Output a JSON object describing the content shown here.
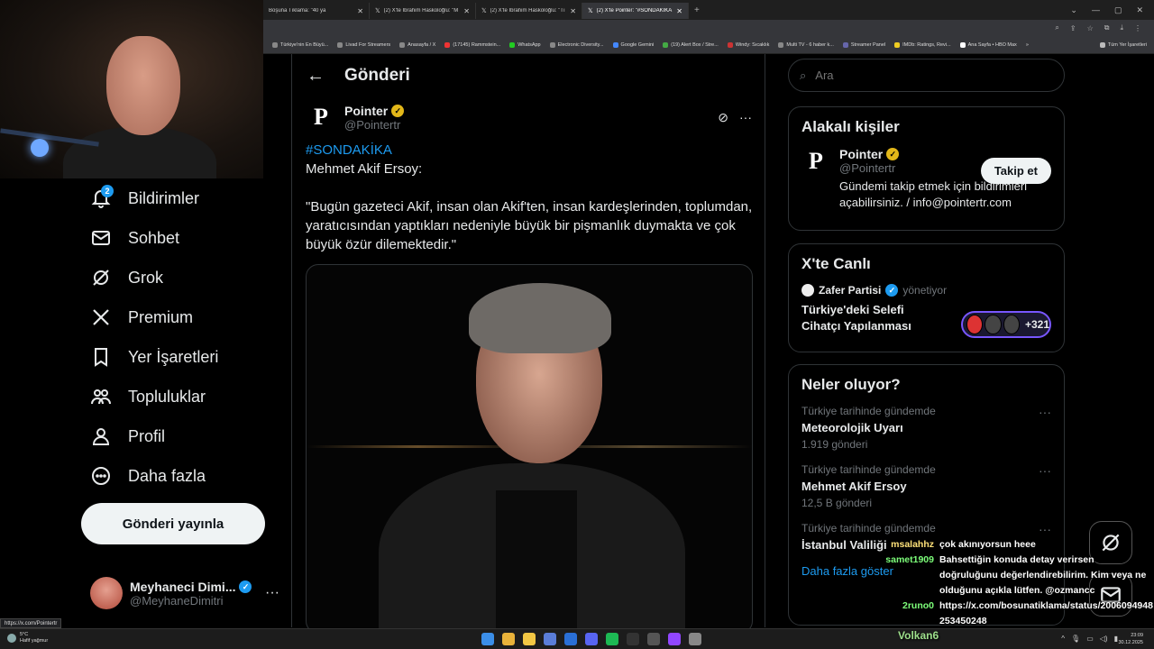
{
  "browser": {
    "tabs": [
      {
        "title": "Boşuna Tıklama: \"40 ya",
        "active": false
      },
      {
        "title": "(2) X'te İbrahim Haskoloğlu: \"M",
        "active": false
      },
      {
        "title": "(2) X'te İbrahim Haskoloğlu: \"Tı",
        "active": false
      },
      {
        "title": "(2) X'te Pointer: \"#SONDAKİKA",
        "active": true
      }
    ],
    "bookmarks": [
      "Türkiye'nin En Büyü...",
      "Livad For Streamers",
      "Anasayfa / X",
      "(17145) Rammstein...",
      "WhatsApp",
      "Electronic Diversity...",
      "Google Gemini",
      "(19) Alert Box / Stre...",
      "Windy: Sıcaklık",
      "Multi TV - 6 haber k...",
      "Streamer Panel",
      "IMDb: Ratings, Revi...",
      "Ana Sayfa • HBO Max"
    ],
    "bookmarks_folder": "Tüm Yer İşaretleri",
    "status_url": "https://x.com/Pointertr"
  },
  "nav": {
    "items": [
      {
        "label": "Bildirimler",
        "icon": "bell-icon",
        "badge": "2"
      },
      {
        "label": "Sohbet",
        "icon": "mail-icon"
      },
      {
        "label": "Grok",
        "icon": "grok-icon"
      },
      {
        "label": "Premium",
        "icon": "x-logo-icon"
      },
      {
        "label": "Yer İşaretleri",
        "icon": "bookmark-icon"
      },
      {
        "label": "Topluluklar",
        "icon": "communities-icon"
      },
      {
        "label": "Profil",
        "icon": "person-icon"
      },
      {
        "label": "Daha fazla",
        "icon": "more-circle-icon"
      }
    ],
    "post_button": "Gönderi yayınla",
    "account": {
      "name": "Meyhaneci Dimi...",
      "handle": "@MeyhaneDimitri",
      "more": "···"
    }
  },
  "post": {
    "header_title": "Gönderi",
    "author_name": "Pointer",
    "author_handle": "@Pointertr",
    "hashtag": "#SONDAKİKA",
    "line1": "Mehmet Akif Ersoy:",
    "quote": "\"Bugün gazeteci Akif, insan olan Akif'ten, insan kardeşlerinden, toplumdan, yaratıcısından yaptıkları nedeniyle büyük bir pişmanlık duymakta ve çok büyük özür dilemektedir.\""
  },
  "sidebar": {
    "search_placeholder": "Ara",
    "related": {
      "title": "Alakalı kişiler",
      "name": "Pointer",
      "handle": "@Pointertr",
      "bio": "Gündemi takip etmek için bildirimleri açabilirsiniz. / info@pointertr.com",
      "follow": "Takip et"
    },
    "live": {
      "title": "X'te Canlı",
      "host": "Zafer Partisi",
      "host_role": "yönetiyor",
      "space_title": "Türkiye'deki Selefi Cihatçı Yapılanması",
      "listeners": "+321"
    },
    "trends": {
      "title": "Neler oluyor?",
      "items": [
        {
          "context": "Türkiye tarihinde gündemde",
          "topic": "Meteorolojik Uyarı",
          "count": "1.919 gönderi"
        },
        {
          "context": "Türkiye tarihinde gündemde",
          "topic": "Mehmet Akif Ersoy",
          "count": "12,5 B gönderi"
        },
        {
          "context": "Türkiye tarihinde gündemde",
          "topic": "İstanbul Valiliği",
          "count": ""
        }
      ],
      "show_more": "Daha fazla göster"
    }
  },
  "chat": {
    "messages": [
      {
        "user": "msalahhz",
        "text": "çok akınıyorsun heee",
        "color": "#ffe27a"
      },
      {
        "user": "samet1909",
        "text": "Bahsettiğin konuda detay verirsen doğruluğunu değerlendirebilirim. Kim veya ne olduğunu açıkla lütfen. @ozmancc",
        "color": "#7dff7a"
      },
      {
        "user": "2runo0",
        "text": "https://x.com/bosunatiklama/status/2006094948253450248",
        "color": "#7dff7a"
      }
    ],
    "footer_user": "Volkan6"
  },
  "taskbar": {
    "weather_temp": "5°C",
    "weather_desc": "Hafif yağmur",
    "time": "23:09",
    "date": "30.12.2025"
  }
}
